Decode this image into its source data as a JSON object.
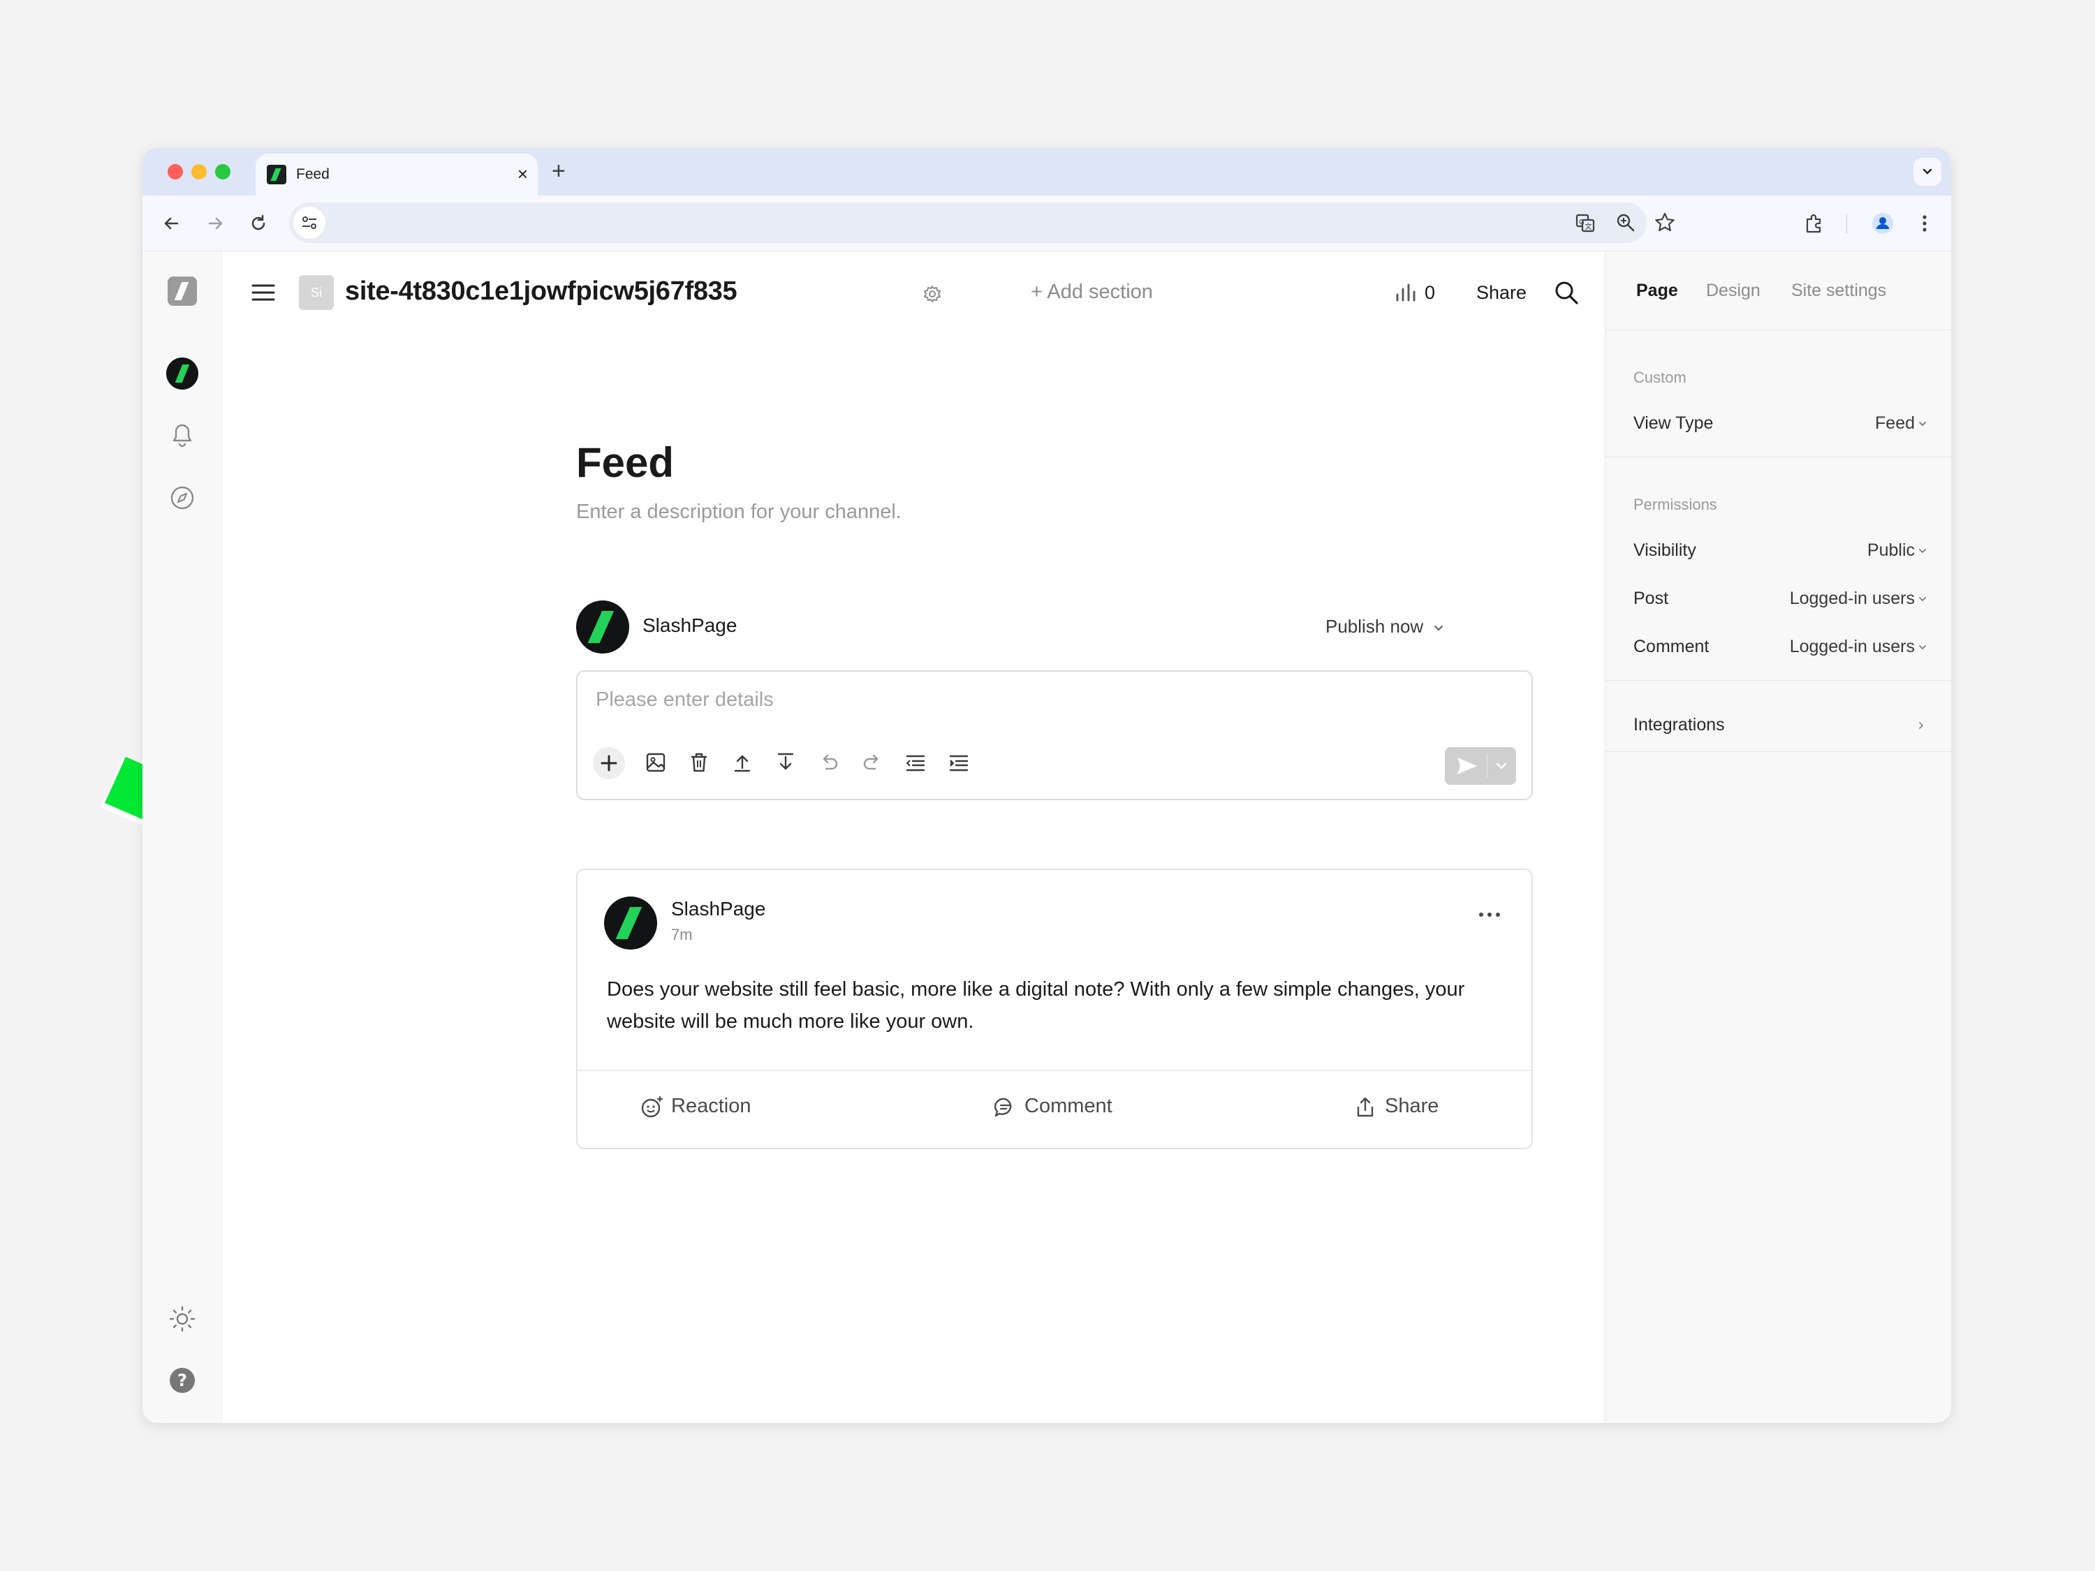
{
  "browser": {
    "tab_title": "Feed",
    "tab_close": "×",
    "new_tab": "+"
  },
  "header": {
    "site_badge": "Si",
    "site_name": "site-4t830c1e1jowfpicw5j67f835",
    "add_section": "+ Add section",
    "stats_count": "0",
    "share_label": "Share"
  },
  "sidebar_right": {
    "tabs": [
      {
        "label": "Page"
      },
      {
        "label": "Design"
      },
      {
        "label": "Site settings"
      }
    ],
    "custom": {
      "section_label": "Custom",
      "view_type_label": "View Type",
      "view_type_value": "Feed"
    },
    "permissions": {
      "section_label": "Permissions",
      "visibility_label": "Visibility",
      "visibility_value": "Public",
      "post_label": "Post",
      "post_value": "Logged-in users",
      "comment_label": "Comment",
      "comment_value": "Logged-in users"
    },
    "integrations_label": "Integrations"
  },
  "feed": {
    "title": "Feed",
    "description": "Enter a description for your channel."
  },
  "composer": {
    "author": "SlashPage",
    "publish_label": "Publish now",
    "placeholder": "Please enter details"
  },
  "post": {
    "author": "SlashPage",
    "time": "7m",
    "body": "Does your website still feel basic, more like a digital note? With only a few simple changes, your website will be much more like your own.",
    "actions": {
      "reaction": "Reaction",
      "comment": "Comment",
      "share": "Share"
    }
  },
  "colors": {
    "accent_green": "#22d35a",
    "arrow_green": "#00e834",
    "toggle_dark": "#1b1b1b"
  }
}
